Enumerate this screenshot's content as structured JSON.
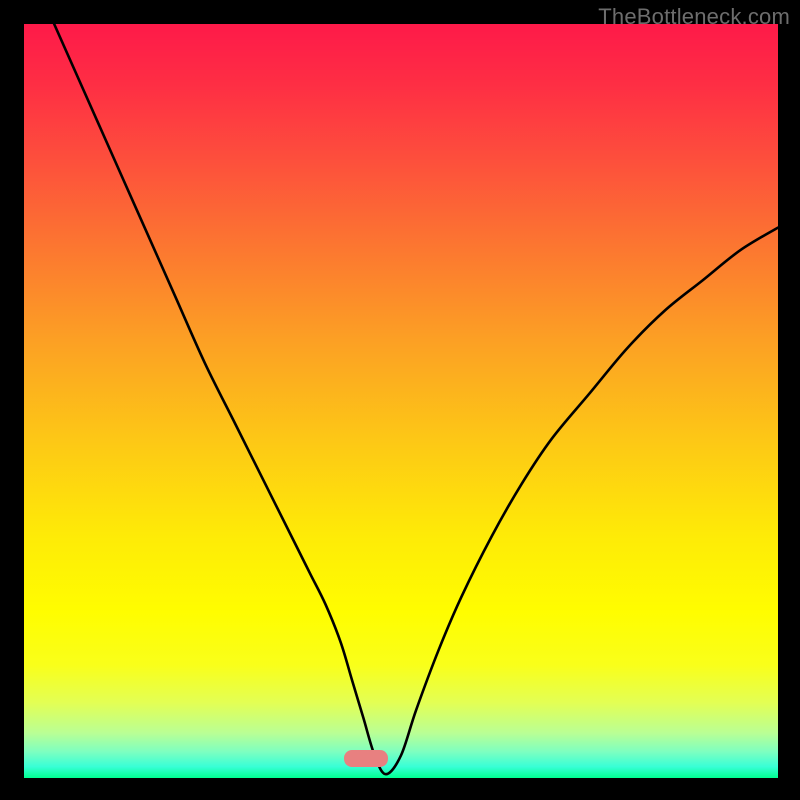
{
  "watermark": "TheBottleneck.com",
  "gradient": {
    "stops": [
      {
        "offset": 0.0,
        "color": "#fe1a49"
      },
      {
        "offset": 0.08,
        "color": "#fe2e44"
      },
      {
        "offset": 0.18,
        "color": "#fd4f3c"
      },
      {
        "offset": 0.3,
        "color": "#fc7830"
      },
      {
        "offset": 0.42,
        "color": "#fca024"
      },
      {
        "offset": 0.55,
        "color": "#fdc716"
      },
      {
        "offset": 0.68,
        "color": "#feeb07"
      },
      {
        "offset": 0.78,
        "color": "#fffd00"
      },
      {
        "offset": 0.85,
        "color": "#f9ff1a"
      },
      {
        "offset": 0.9,
        "color": "#e3ff54"
      },
      {
        "offset": 0.94,
        "color": "#baff94"
      },
      {
        "offset": 0.965,
        "color": "#7effc0"
      },
      {
        "offset": 0.985,
        "color": "#38ffd6"
      },
      {
        "offset": 1.0,
        "color": "#00ff91"
      }
    ]
  },
  "marker": {
    "left_frac": 0.425,
    "bottom_frac": 0.015,
    "width_frac": 0.058,
    "height_frac": 0.022
  },
  "chart_data": {
    "type": "line",
    "title": "",
    "xlabel": "",
    "ylabel": "",
    "xlim": [
      0,
      100
    ],
    "ylim": [
      0,
      100
    ],
    "grid": false,
    "series": [
      {
        "name": "curve",
        "x": [
          4,
          8,
          12,
          16,
          20,
          24,
          28,
          32,
          36,
          38,
          40,
          42,
          43.5,
          45,
          46.5,
          48,
          50,
          52,
          55,
          58,
          62,
          66,
          70,
          75,
          80,
          85,
          90,
          95,
          100
        ],
        "y": [
          100,
          91,
          82,
          73,
          64,
          55,
          47,
          39,
          31,
          27,
          23,
          18,
          13,
          8,
          3,
          0.5,
          3,
          9,
          17,
          24,
          32,
          39,
          45,
          51,
          57,
          62,
          66,
          70,
          73
        ]
      }
    ],
    "minimum_marker": {
      "x": 47.5,
      "y": 0.5
    }
  }
}
